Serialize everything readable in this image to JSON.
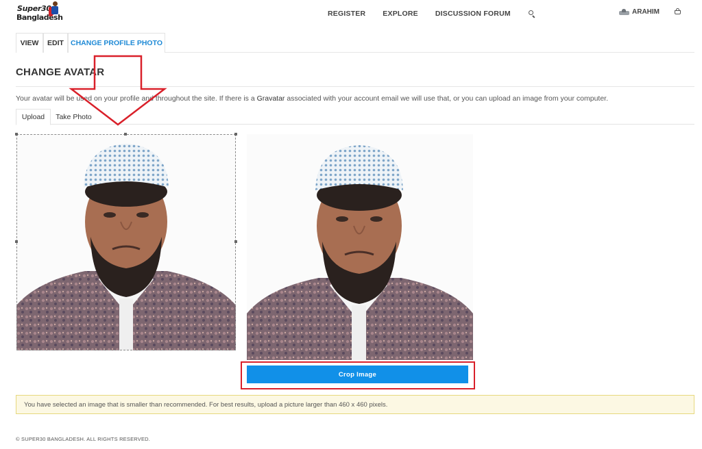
{
  "logo": {
    "line1": "Super30",
    "line2": "Bangladesh"
  },
  "nav": {
    "links": [
      "REGISTER",
      "EXPLORE",
      "DISCUSSION FORUM"
    ],
    "search_icon": "search-icon",
    "user_name": "ARAHIM",
    "cart_icon": "basket-icon"
  },
  "profile_tabs": [
    {
      "label": "VIEW",
      "active": false
    },
    {
      "label": "EDIT",
      "active": false
    },
    {
      "label": "CHANGE PROFILE PHOTO",
      "active": true
    }
  ],
  "page": {
    "heading": "CHANGE AVATAR",
    "description_before": "Your avatar will be used on your profile and throughout the site. If there is a ",
    "description_link": "Gravatar",
    "description_after": " associated with your account email we will use that, or you can upload an image from your computer."
  },
  "upload_tabs": [
    {
      "label": "Upload",
      "active": true
    },
    {
      "label": "Take Photo",
      "active": false
    }
  ],
  "crop": {
    "button_label": "Crop Image"
  },
  "notice": "You have selected an image that is smaller than recommended. For best results, upload a picture larger than 460 x 460 pixels.",
  "footer": "© SUPER30 BANGLADESH. ALL RIGHTS RESERVED.",
  "colors": {
    "accent": "#1f8ad6",
    "button": "#1190e8",
    "annotation": "#d9202a",
    "notice_bg": "#fcf8e3"
  }
}
